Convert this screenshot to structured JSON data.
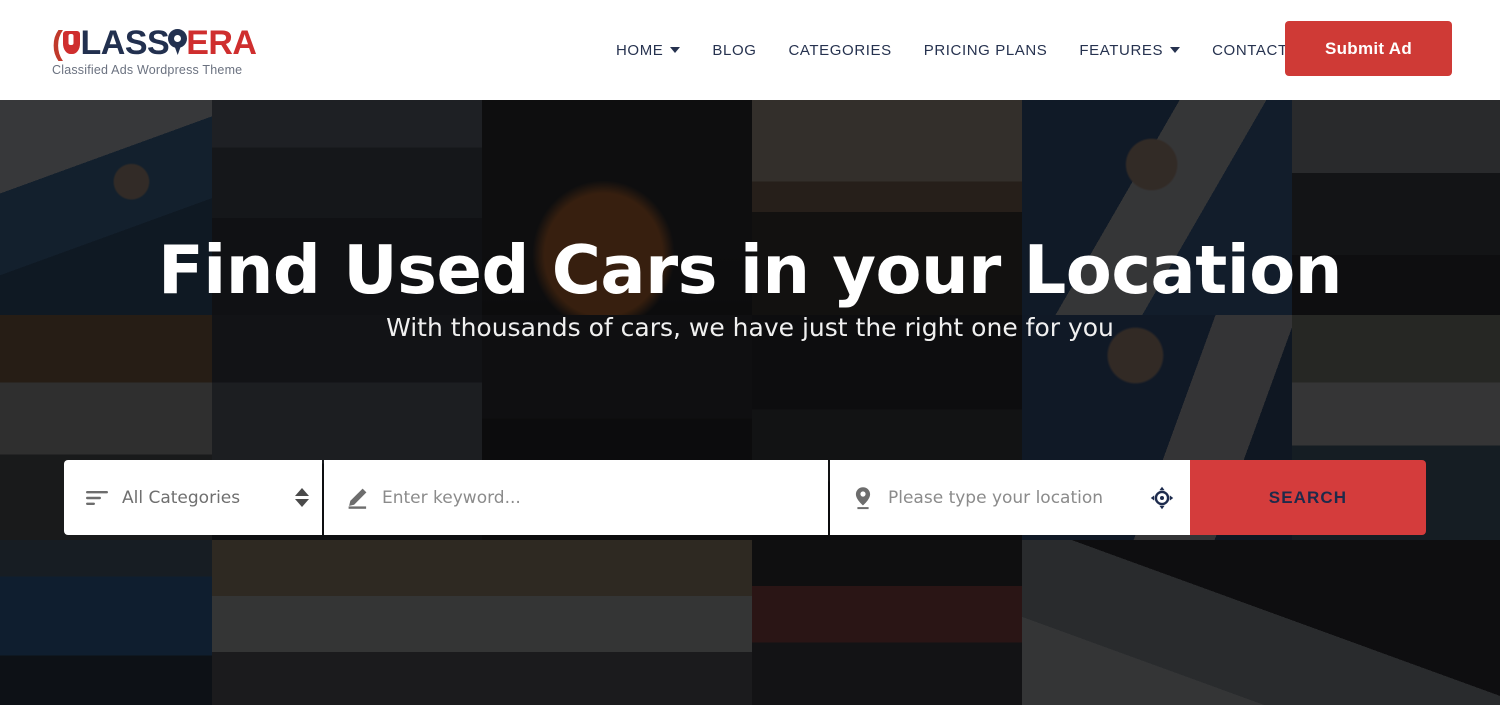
{
  "header": {
    "logo": {
      "bracket": "(",
      "text_part1": "LASS",
      "text_part2": "ERA",
      "tagline": "Classified Ads Wordpress Theme",
      "pin_icon": "location-pin-icon",
      "shield_icon": "shield-icon"
    },
    "nav": [
      {
        "label": "HOME",
        "has_dropdown": true
      },
      {
        "label": "BLOG",
        "has_dropdown": false
      },
      {
        "label": "CATEGORIES",
        "has_dropdown": false
      },
      {
        "label": "PRICING PLANS",
        "has_dropdown": false
      },
      {
        "label": "FEATURES",
        "has_dropdown": true
      },
      {
        "label": "CONTACT",
        "has_dropdown": false
      }
    ],
    "submit_ad_label": "Submit Ad"
  },
  "hero": {
    "title": "Find Used Cars in your Location",
    "subtitle": "With thousands of cars, we have just the right one for you"
  },
  "search": {
    "category": {
      "icon": "list-filter-icon",
      "selected": "All Categories",
      "stepper_icon": "sort-updown-icon"
    },
    "keyword": {
      "icon": "pencil-icon",
      "placeholder": "Enter keyword...",
      "value": ""
    },
    "location": {
      "icon": "map-marker-icon",
      "placeholder": "Please type your location",
      "value": "",
      "gps_icon": "crosshairs-gps-icon"
    },
    "button_label": "SEARCH"
  },
  "colors": {
    "brand_red": "#cf3a36",
    "search_button_red": "#d43c3c",
    "nav_navy": "#26324f",
    "logo_navy": "#22304f",
    "header_bg": "#ffffff",
    "overlay": "rgba(12,12,14,0.80)"
  }
}
